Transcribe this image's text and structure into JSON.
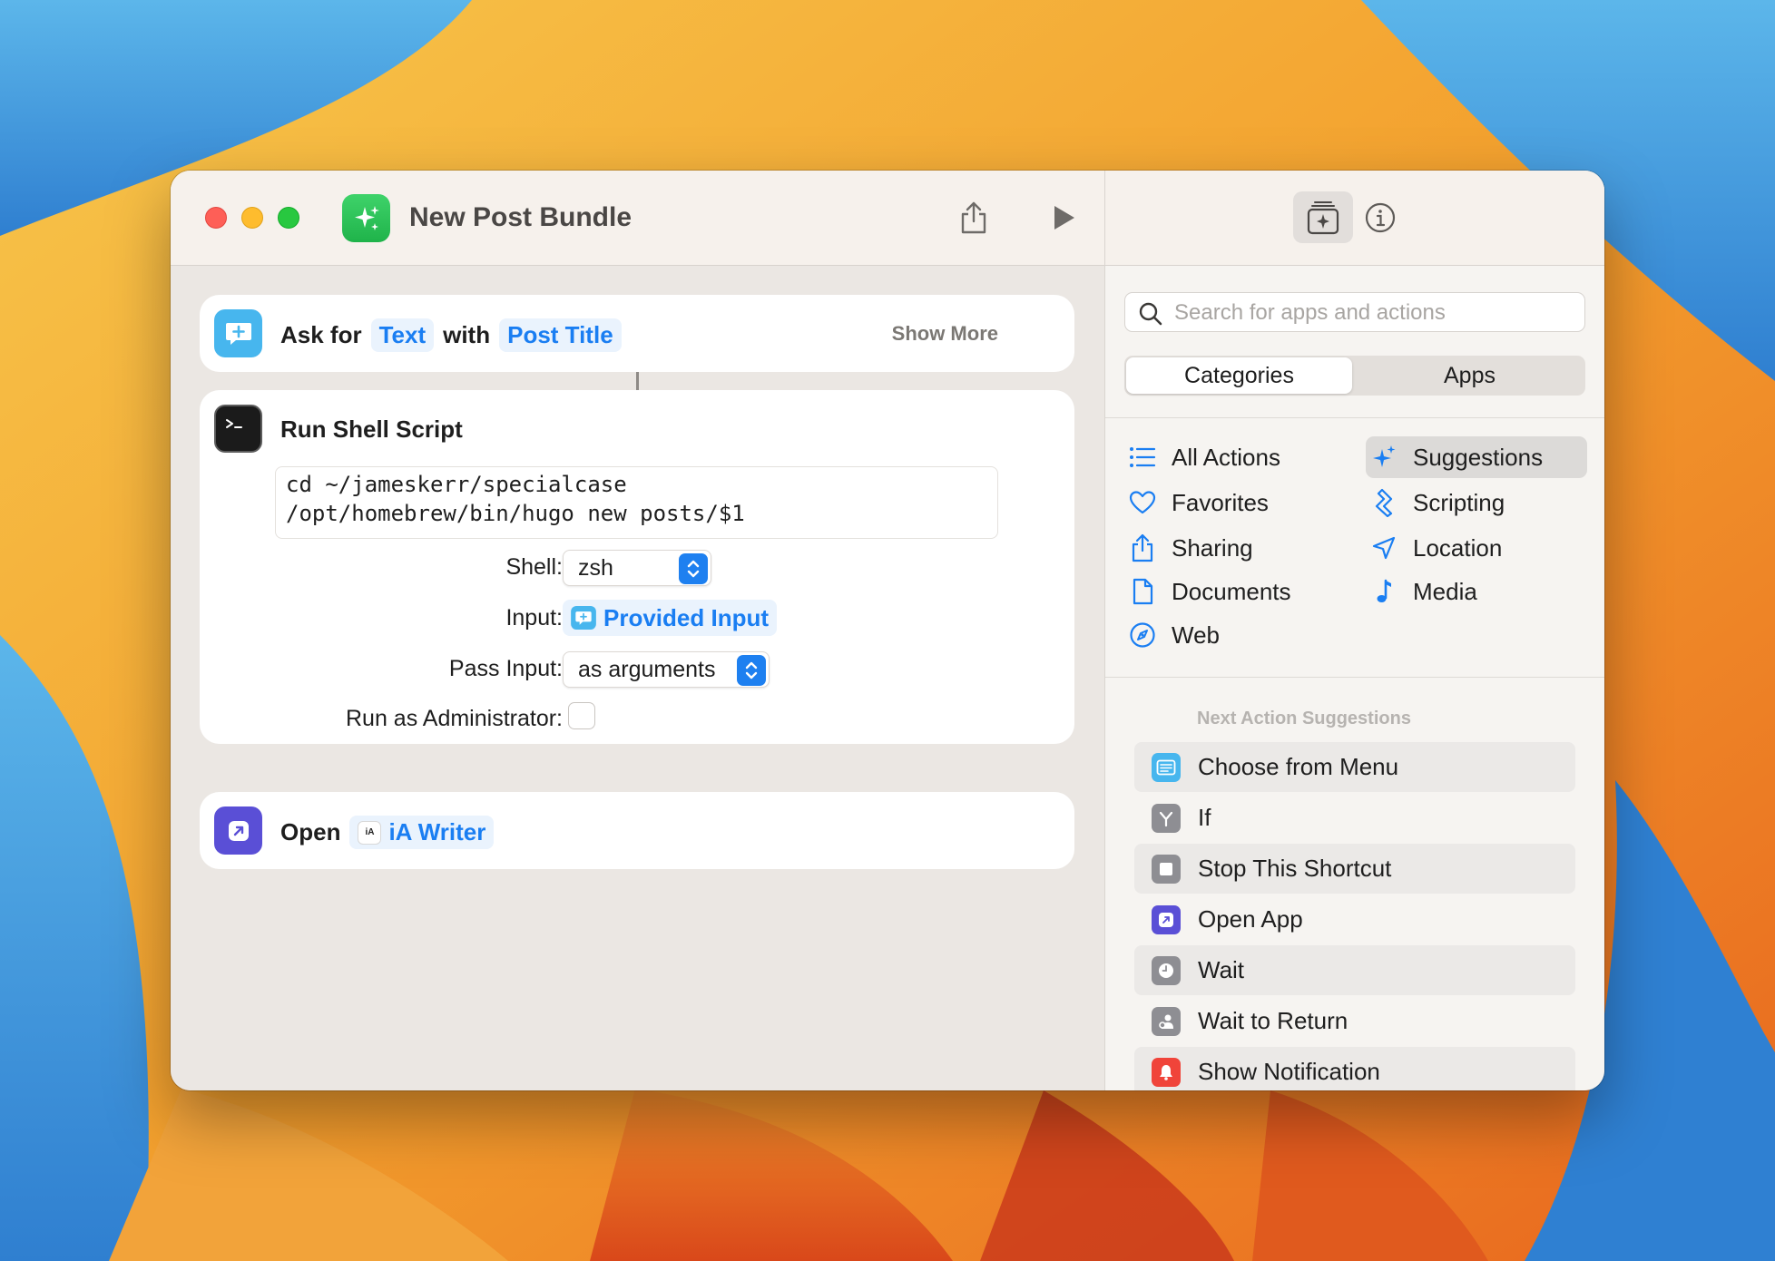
{
  "window": {
    "title": "New Post Bundle"
  },
  "editor": {
    "ask_card": {
      "prefix": "Ask for",
      "token_type": "Text",
      "mid": "with",
      "token_prompt": "Post Title",
      "show_more": "Show More"
    },
    "shell_card": {
      "title": "Run Shell Script",
      "script_lines": [
        "cd ~/jameskerr/specialcase",
        "/opt/homebrew/bin/hugo new posts/$1"
      ],
      "shell_label": "Shell:",
      "shell_value": "zsh",
      "input_label": "Input:",
      "input_value": "Provided Input",
      "pass_input_label": "Pass Input:",
      "pass_input_value": "as arguments",
      "admin_label": "Run as Administrator:",
      "admin_checked": false
    },
    "open_card": {
      "prefix": "Open",
      "app_badge": "iA",
      "app_name": "iA Writer"
    }
  },
  "sidebar": {
    "search_placeholder": "Search for apps and actions",
    "segments": [
      "Categories",
      "Apps"
    ],
    "selected_segment": "Categories",
    "categories": [
      {
        "label": "All Actions",
        "icon": "list-icon"
      },
      {
        "label": "Suggestions",
        "icon": "sparkle-icon",
        "selected": true
      },
      {
        "label": "Favorites",
        "icon": "heart-icon"
      },
      {
        "label": "Scripting",
        "icon": "scripting-icon"
      },
      {
        "label": "Sharing",
        "icon": "share-icon"
      },
      {
        "label": "Location",
        "icon": "location-icon"
      },
      {
        "label": "Documents",
        "icon": "document-icon"
      },
      {
        "label": "Media",
        "icon": "music-note-icon"
      },
      {
        "label": "Web",
        "icon": "compass-icon"
      }
    ],
    "suggestions_heading": "Next Action Suggestions",
    "suggestions": [
      {
        "label": "Choose from Menu",
        "color": "#47b6ee"
      },
      {
        "label": "If",
        "color": "#8e8e93"
      },
      {
        "label": "Stop This Shortcut",
        "color": "#8e8e93"
      },
      {
        "label": "Open App",
        "color": "#5a4fd6"
      },
      {
        "label": "Wait",
        "color": "#8e8e93"
      },
      {
        "label": "Wait to Return",
        "color": "#8e8e93"
      },
      {
        "label": "Show Notification",
        "color": "#f0443a"
      }
    ]
  },
  "colors": {
    "accent": "#1a7ef2",
    "shortcut_icon": "#2cc656"
  }
}
